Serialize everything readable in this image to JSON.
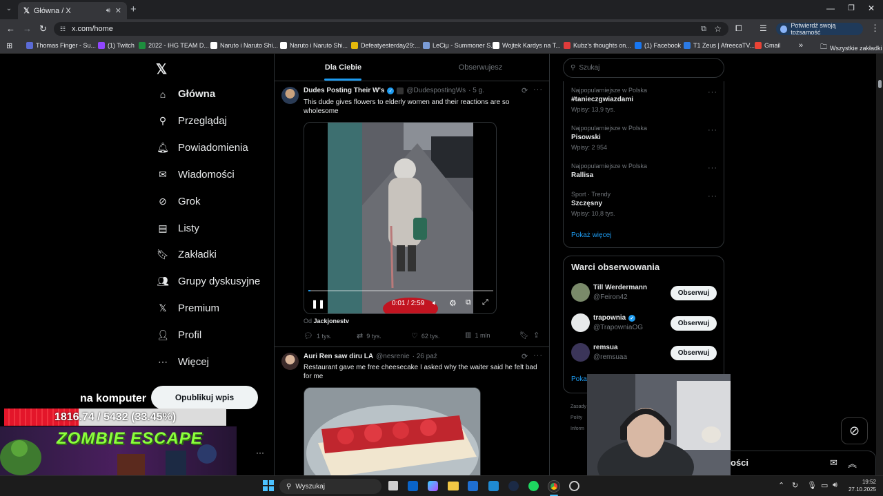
{
  "browser": {
    "tab_title": "Główna / X",
    "url": "x.com/home",
    "verify_label": "Potwierdź swoją tożsamość",
    "bookmarks": [
      {
        "label": "Thomas Finger - Su...",
        "color": "#5b6bd6"
      },
      {
        "label": "(1) Twitch",
        "color": "#9146ff"
      },
      {
        "label": "2022 - IHG TEAM D...",
        "color": "#1e8e3e"
      },
      {
        "label": "Naruto i Naruto Shi...",
        "color": "#ffffff"
      },
      {
        "label": "Naruto i Naruto Shi...",
        "color": "#ffffff"
      },
      {
        "label": "Defeatyesterday29:...",
        "color": "#e5b80b"
      },
      {
        "label": "LeCiµ - Summoner S...",
        "color": "#7b9cd6"
      },
      {
        "label": "Wojtek Kardys na T...",
        "color": "#ffffff"
      },
      {
        "label": "Kubz's thoughts on...",
        "color": "#e03b3b"
      },
      {
        "label": "(1) Facebook",
        "color": "#1877f2"
      },
      {
        "label": "T1 Zeus | AfreecaTV...",
        "color": "#2c7be5"
      },
      {
        "label": "Gmail",
        "color": "#ea4335"
      }
    ],
    "all_bookmarks": "Wszystkie zakładki"
  },
  "sidebar": {
    "items": [
      {
        "label": "Główna",
        "icon": "home-icon"
      },
      {
        "label": "Przeglądaj",
        "icon": "search-icon"
      },
      {
        "label": "Powiadomienia",
        "icon": "bell-icon"
      },
      {
        "label": "Wiadomości",
        "icon": "mail-icon"
      },
      {
        "label": "Grok",
        "icon": "grok-icon"
      },
      {
        "label": "Listy",
        "icon": "list-icon"
      },
      {
        "label": "Zakładki",
        "icon": "bookmark-icon"
      },
      {
        "label": "Grupy dyskusyjne",
        "icon": "people-icon"
      },
      {
        "label": "Premium",
        "icon": "x-icon"
      },
      {
        "label": "Profil",
        "icon": "user-icon"
      },
      {
        "label": "Więcej",
        "icon": "more-icon"
      }
    ],
    "post_button": "Opublikuj wpis"
  },
  "feed": {
    "tabs": [
      "Dla Ciebie",
      "Obserwujesz"
    ],
    "post1": {
      "name": "Dudes Posting Their W's",
      "handle": "@DudespostingWs",
      "time": "· 5 g.",
      "text": "This dude gives flowers to elderly women and their reactions are so wholesome",
      "video_time": "0:01 / 2:59",
      "source_prefix": "Od",
      "source_name": "Jackjonestv",
      "replies": "1 tys.",
      "reposts": "9 tys.",
      "likes": "62 tys.",
      "views": "1 mln",
      "progress": 0.01
    },
    "post2": {
      "name": "Auri Ren saw diru LA",
      "handle": "@nesrenie",
      "time": "· 26 paź",
      "text": "Restaurant gave me free cheesecake I asked why the waiter said he felt bad for me"
    }
  },
  "right": {
    "search_placeholder": "Szukaj",
    "trends": [
      {
        "context": "Najpopularniejsze w Polska",
        "name": "#tanieczgwiazdami",
        "count": "Wpisy: 13,9 tys."
      },
      {
        "context": "Najpopularniejsze w Polska",
        "name": "Pisowski",
        "count": "Wpisy: 2 954"
      },
      {
        "context": "Najpopularniejsze w Polska",
        "name": "Rallisa",
        "count": ""
      },
      {
        "context": "Sport · Trendy",
        "name": "Szczęsny",
        "count": "Wpisy: 10,8 tys."
      }
    ],
    "show_more": "Pokaż więcej",
    "who_to_follow_title": "Warci obserwowania",
    "follow": [
      {
        "name": "Till Werdermann",
        "handle": "@Feiron42",
        "button": "Obserwuj"
      },
      {
        "name": "trapownia",
        "handle": "@TrapowniaOG",
        "button": "Obserwuj"
      },
      {
        "name": "remsua",
        "handle": "@remsuaa",
        "button": "Obserwuj"
      }
    ],
    "show_more_partial": "Pokaż",
    "footer_lines": [
      "Zasady",
      "Polity",
      "Inform"
    ],
    "messages_partial": "ości"
  },
  "overlay": {
    "stream_text": "na komputer",
    "progress_text": "1816.74 / 5432 (33.45%)",
    "progress_fraction": 0.3345,
    "game_title": "ZOMBIE ESCAPE"
  },
  "taskbar": {
    "search": "Wyszukaj",
    "time": "19:52",
    "date": "27.10.2025"
  }
}
